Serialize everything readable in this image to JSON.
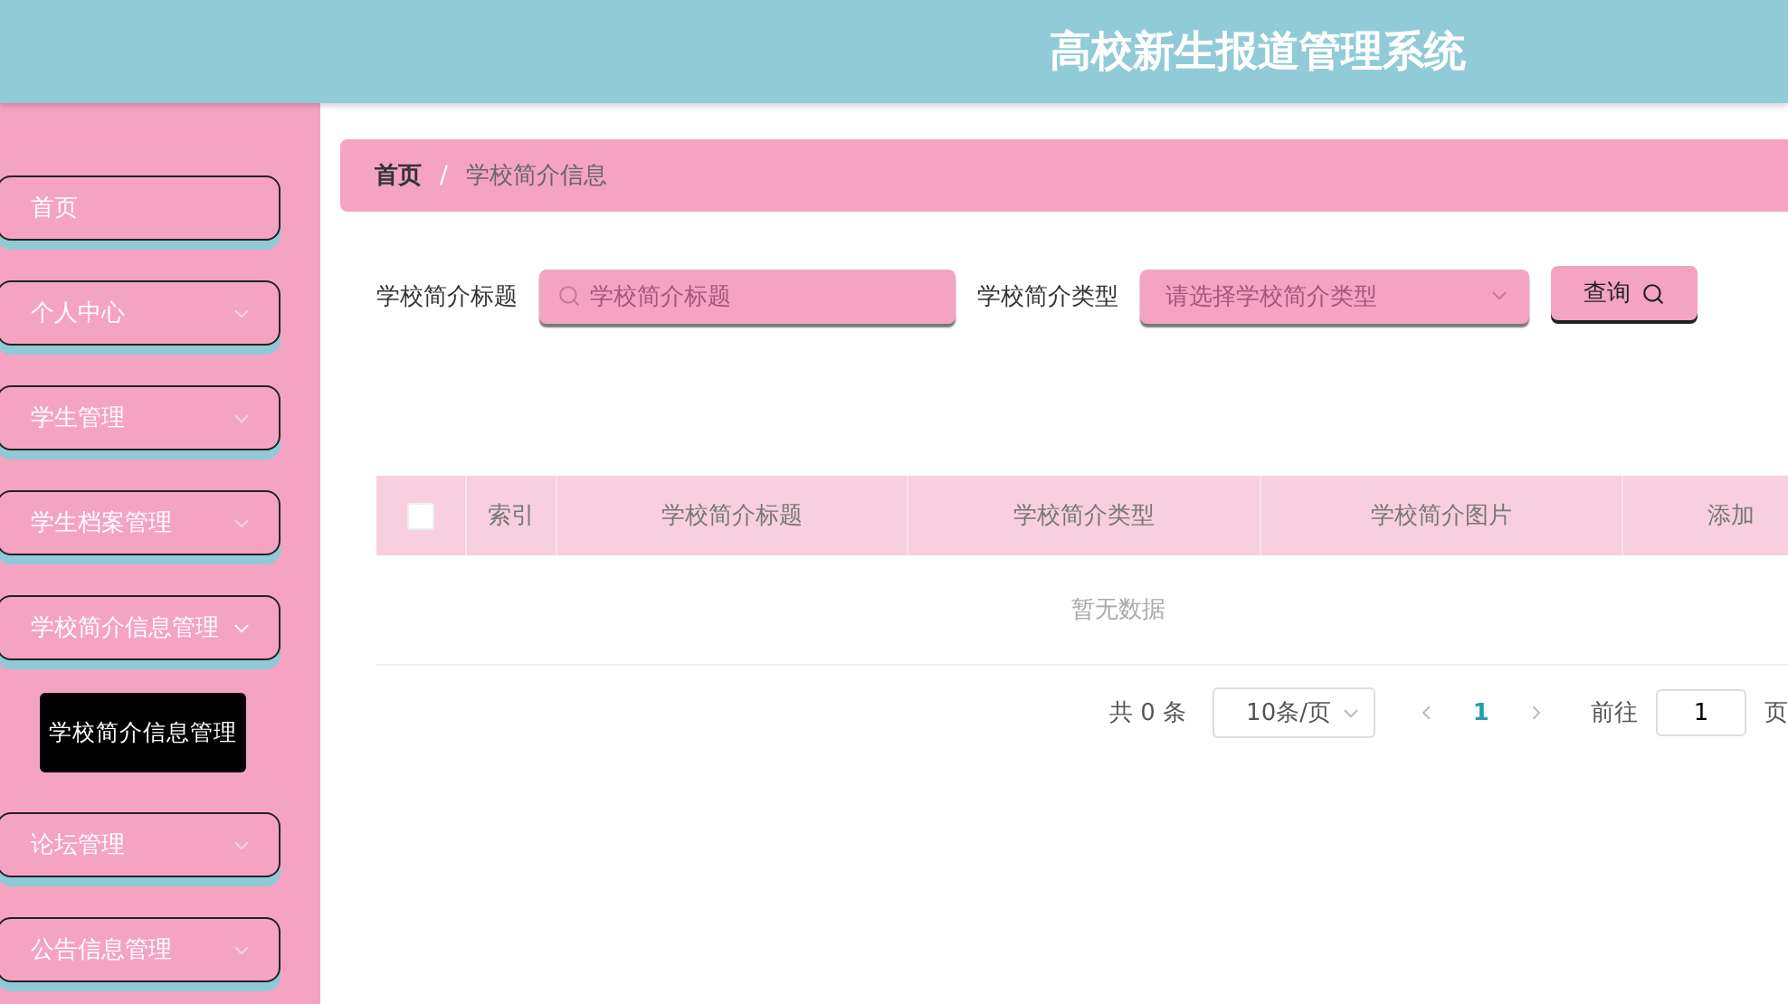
{
  "header": {
    "title": "高校新生报道管理系统"
  },
  "sidebar": {
    "items": [
      {
        "label": "首页"
      },
      {
        "label": "个人中心",
        "expanded": false
      },
      {
        "label": "学生管理",
        "expanded": false
      },
      {
        "label": "学生档案管理",
        "expanded": false
      },
      {
        "label": "学校简介信息管理",
        "expanded": true,
        "children": [
          {
            "label": "学校简介信息管理",
            "selected": true
          }
        ]
      },
      {
        "label": "论坛管理",
        "expanded": false
      },
      {
        "label": "公告信息管理",
        "expanded": false
      }
    ]
  },
  "breadcrumb": {
    "separator": "/",
    "items": [
      "首页",
      "学校简介信息"
    ]
  },
  "search": {
    "fields": [
      {
        "label": "学校简介标题",
        "kind": "text",
        "placeholder": "学校简介标题"
      },
      {
        "label": "学校简介类型",
        "kind": "select",
        "placeholder": "请选择学校简介类型"
      }
    ],
    "button": "查询"
  },
  "table": {
    "select_all_checked": false,
    "columns": [
      "索引",
      "学校简介标题",
      "学校简介类型",
      "学校简介图片",
      "添加"
    ],
    "empty_text": "暂无数据"
  },
  "pagination": {
    "total": "共 0 条",
    "page_size": "10条/页",
    "pages": [
      {
        "label": "1",
        "selected": true
      }
    ],
    "goto_label": "前往",
    "goto_value": "1",
    "goto_suffix": "页"
  }
}
